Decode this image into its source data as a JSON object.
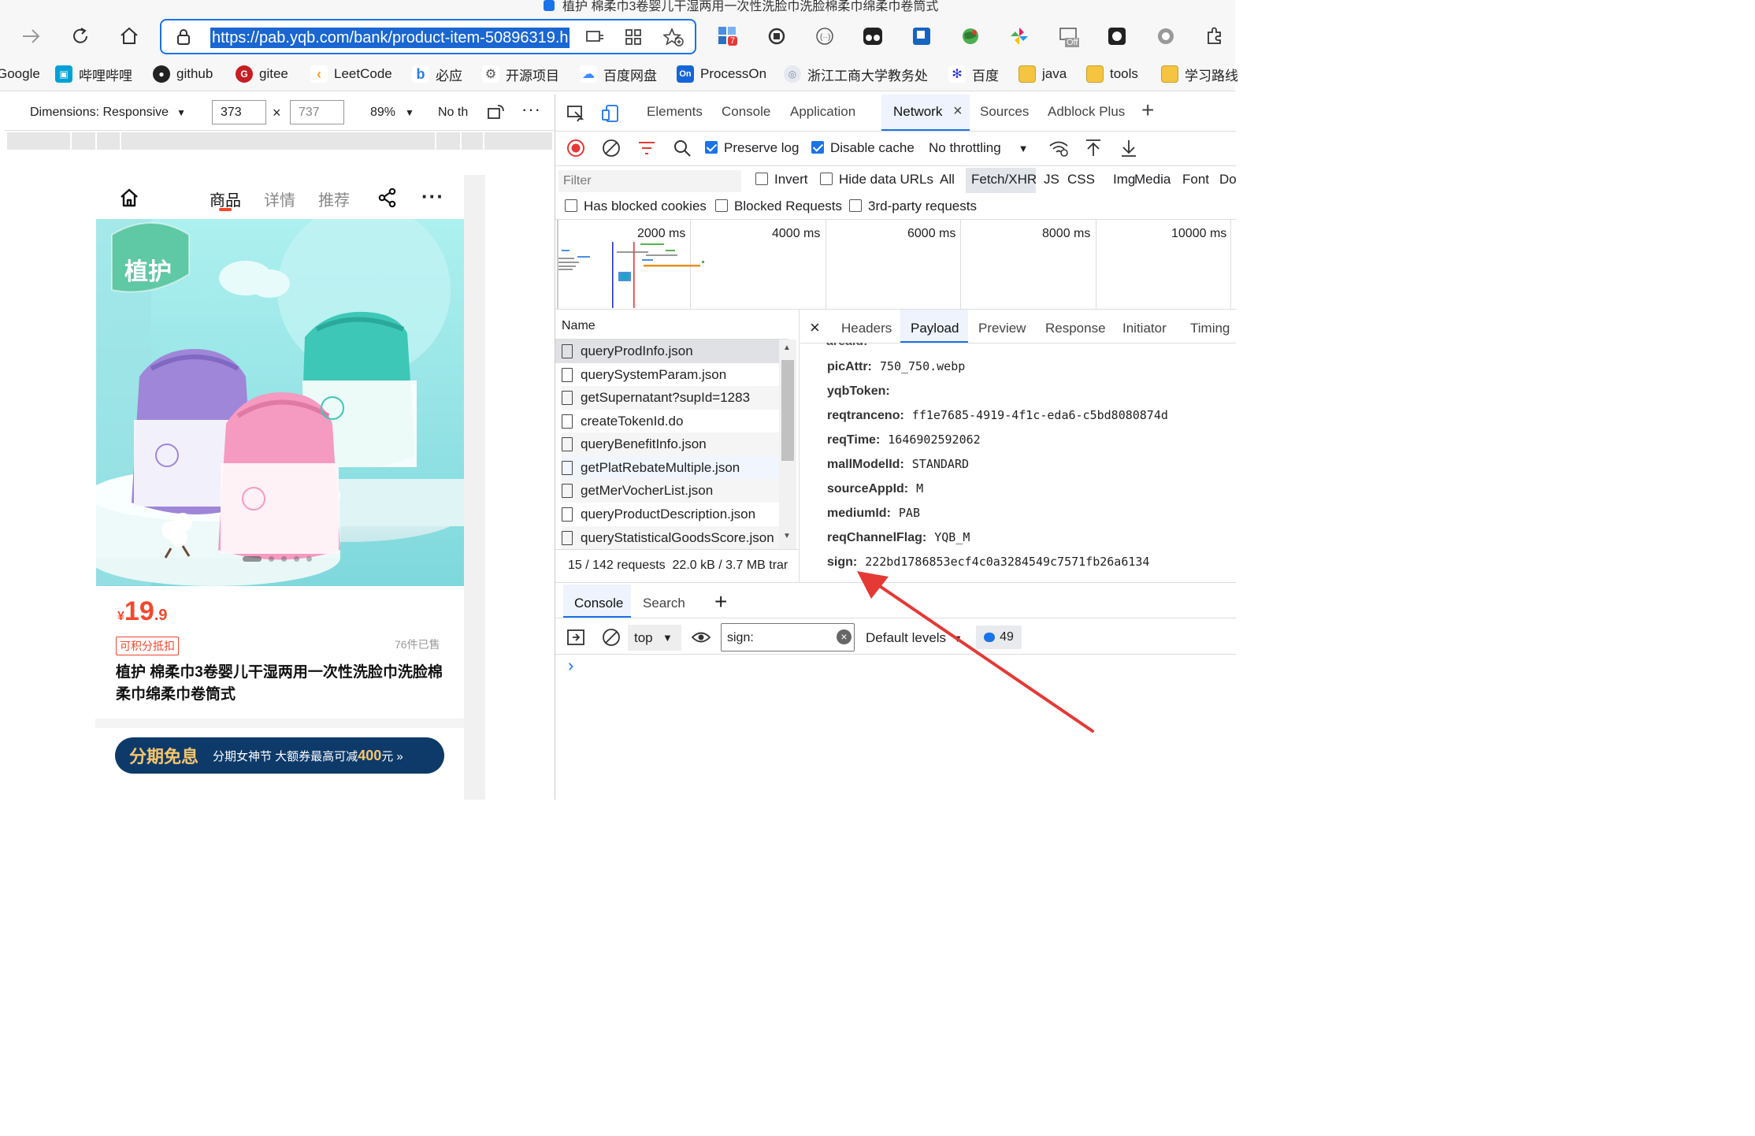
{
  "browser": {
    "title_strip": "植护 棉柔巾3卷婴儿干湿两用一次性洗脸巾洗脸棉柔巾绵柔巾卷筒式",
    "url": "https://pab.yqb.com/bank/product-item-50896319.h",
    "extension_badge": "7",
    "extension_off_label": "Off",
    "bookmarks": [
      {
        "label": "Google",
        "icon": "google-icon",
        "color": "#4285f4"
      },
      {
        "label": "哔哩哔哩",
        "icon": "bilibili-icon",
        "color": "#00a1d6"
      },
      {
        "label": "github",
        "icon": "github-icon",
        "color": "#222222"
      },
      {
        "label": "gitee",
        "icon": "gitee-icon",
        "color": "#c71d23"
      },
      {
        "label": "LeetCode",
        "icon": "leetcode-icon",
        "color": "#f89f1b"
      },
      {
        "label": "必应",
        "icon": "bing-icon",
        "color": "#2a7de1"
      },
      {
        "label": "开源项目",
        "icon": "opensource-icon",
        "color": "#555555"
      },
      {
        "label": "百度网盘",
        "icon": "baidu-netdisk-icon",
        "color": "#3b8cff"
      },
      {
        "label": "ProcessOn",
        "icon": "processon-icon",
        "color": "#1565d8"
      },
      {
        "label": "浙江工商大学教务处",
        "icon": "university-icon",
        "color": "#7a8aa8"
      },
      {
        "label": "百度",
        "icon": "baidu-icon",
        "color": "#2932e1"
      },
      {
        "label": "java",
        "icon": "folder-icon",
        "color": "#f5c542"
      },
      {
        "label": "tools",
        "icon": "folder-icon",
        "color": "#f5c542"
      },
      {
        "label": "学习路线",
        "icon": "folder-icon",
        "color": "#f5c542"
      }
    ]
  },
  "device_toolbar": {
    "dimensions_label": "Dimensions: Responsive",
    "width": "373",
    "height": "737",
    "zoom": "89%",
    "throttle": "No th"
  },
  "phone": {
    "nav_tabs": [
      "商品",
      "详情",
      "推荐"
    ],
    "brand_badge": "植护",
    "price_currency": "¥",
    "price_int": "19",
    "price_dec": ".9",
    "points_tag": "可积分抵扣",
    "sold": "76件已售",
    "product_title": "植护 棉柔巾3卷婴儿干湿两用一次性洗脸巾洗脸棉柔巾绵柔巾卷筒式",
    "banner_main": "分期免息",
    "banner_sub_prefix": "分期女神节 大额券最高可减",
    "banner_amount": "400",
    "banner_suffix": "元 »",
    "carousel_dots": 5
  },
  "devtools": {
    "tabs": [
      "Elements",
      "Console",
      "Application",
      "Network",
      "Sources",
      "Adblock Plus"
    ],
    "active_tab": "Network",
    "preserve_log": "Preserve log",
    "disable_cache": "Disable cache",
    "throttling": "No throttling",
    "filter_placeholder": "Filter",
    "filter_opts": [
      "Invert",
      "Hide data URLs"
    ],
    "type_filters": [
      "All",
      "Fetch/XHR",
      "JS",
      "CSS",
      "Img",
      "Media",
      "Font",
      "Do"
    ],
    "active_type": "Fetch/XHR",
    "extra_filters": [
      "Has blocked cookies",
      "Blocked Requests",
      "3rd-party requests"
    ],
    "timeline_ticks": [
      "2000 ms",
      "4000 ms",
      "6000 ms",
      "8000 ms",
      "10000 ms"
    ],
    "name_header": "Name",
    "requests": [
      "queryProdInfo.json",
      "querySystemParam.json",
      "getSupernatant?supId=1283",
      "createTokenId.do",
      "queryBenefitInfo.json",
      "getPlatRebateMultiple.json",
      "getMerVocherList.json",
      "queryProductDescription.json",
      "queryStatisticalGoodsScore.json"
    ],
    "summary": "15 / 142 requests  22.0 kB / 3.7 MB trar",
    "detail_tabs": [
      "Headers",
      "Payload",
      "Preview",
      "Response",
      "Initiator",
      "Timing"
    ],
    "active_detail": "Payload",
    "payload": [
      {
        "key": "picAttr:",
        "value": "750_750.webp"
      },
      {
        "key": "yqbToken:",
        "value": ""
      },
      {
        "key": "reqtranceno:",
        "value": "ff1e7685-4919-4f1c-eda6-c5bd8080874d"
      },
      {
        "key": "reqTime:",
        "value": "1646902592062"
      },
      {
        "key": "mallModelId:",
        "value": "STANDARD"
      },
      {
        "key": "sourceAppId:",
        "value": "M"
      },
      {
        "key": "mediumId:",
        "value": "PAB"
      },
      {
        "key": "reqChannelFlag:",
        "value": "YQB_M"
      },
      {
        "key": "sign:",
        "value": "222bd1786853ecf4c0a3284549c7571fb26a6134"
      }
    ],
    "drawer_tabs": [
      "Console",
      "Search"
    ],
    "context": "top",
    "console_filter": "sign:",
    "levels": "Default levels",
    "message_count": "49",
    "prompt": "›"
  },
  "colors": {
    "accent": "#1a73e8",
    "price": "#f5462b",
    "arrow": "#e53935",
    "record": "#e53935"
  }
}
